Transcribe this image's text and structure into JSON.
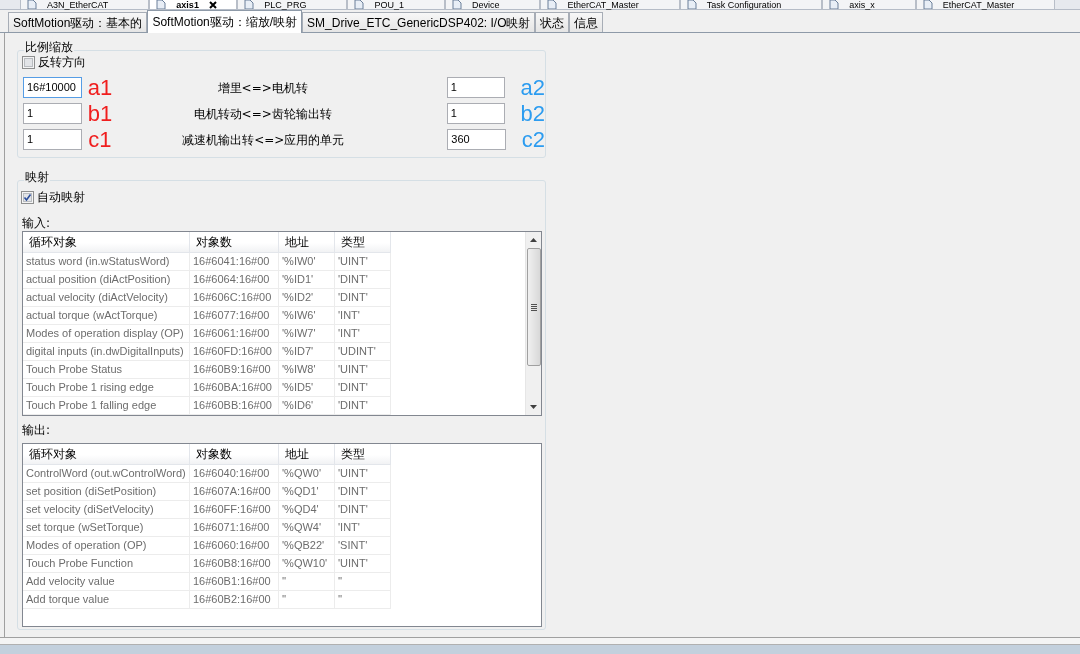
{
  "editor_tabs": [
    {
      "label": "A3N_EtherCAT",
      "selected": false
    },
    {
      "label": "axis1",
      "selected": true
    },
    {
      "label": "PLC_PRG",
      "selected": false
    },
    {
      "label": "POU_1",
      "selected": false
    },
    {
      "label": "Device",
      "selected": false
    },
    {
      "label": "EtherCAT_Master",
      "selected": false
    },
    {
      "label": "Task Configuration",
      "selected": false
    },
    {
      "label": "axis_x",
      "selected": false
    },
    {
      "label": "EtherCAT_Master",
      "selected": false
    }
  ],
  "subtabs": [
    {
      "label": "SoftMotion驱动：基本的",
      "selected": false
    },
    {
      "label": "SoftMotion驱动：缩放/映射",
      "selected": true
    },
    {
      "label": "SM_Drive_ETC_GenericDSP402: I/O映射",
      "selected": false
    },
    {
      "label": "状态",
      "selected": false
    },
    {
      "label": "信息",
      "selected": false
    }
  ],
  "scaling": {
    "title": "比例缩放",
    "invert": {
      "label": "反转方向",
      "checked": false
    },
    "rows": [
      {
        "left": {
          "value": "16#10000",
          "focused": true
        },
        "left_note": "a1",
        "label": "增里<=>电机转",
        "right": {
          "value": "1",
          "focused": false
        },
        "right_note": "a2"
      },
      {
        "left": {
          "value": "1",
          "focused": false
        },
        "left_note": "b1",
        "label": "电机转动<=>齿轮输出转",
        "right": {
          "value": "1",
          "focused": false
        },
        "right_note": "b2"
      },
      {
        "left": {
          "value": "1",
          "focused": false
        },
        "left_note": "c1",
        "label": "减速机输出转<=>应用的单元",
        "right": {
          "value": "360",
          "focused": false
        },
        "right_note": "c2"
      }
    ]
  },
  "mapping": {
    "title": "映射",
    "auto_map": {
      "label": "自动映射",
      "checked": true
    },
    "inputs": {
      "title": "输入:",
      "columns": [
        "循环对象",
        "对象数",
        "地址",
        "类型"
      ],
      "rows": [
        [
          "status word (in.wStatusWord)",
          "16#6041:16#00",
          "'%IW0'",
          "'UINT'"
        ],
        [
          "actual position (diActPosition)",
          "16#6064:16#00",
          "'%ID1'",
          "'DINT'"
        ],
        [
          "actual velocity (diActVelocity)",
          "16#606C:16#00",
          "'%ID2'",
          "'DINT'"
        ],
        [
          "actual torque (wActTorque)",
          "16#6077:16#00",
          "'%IW6'",
          "'INT'"
        ],
        [
          "Modes of operation display (OP)",
          "16#6061:16#00",
          "'%IW7'",
          "'INT'"
        ],
        [
          "digital inputs (in.dwDigitalInputs)",
          "16#60FD:16#00",
          "'%ID7'",
          "'UDINT'"
        ],
        [
          "Touch Probe Status",
          "16#60B9:16#00",
          "'%IW8'",
          "'UINT'"
        ],
        [
          "Touch Probe 1 rising edge",
          "16#60BA:16#00",
          "'%ID5'",
          "'DINT'"
        ],
        [
          "Touch Probe 1 falling edge",
          "16#60BB:16#00",
          "'%ID6'",
          "'DINT'"
        ]
      ]
    },
    "outputs": {
      "title": "输出:",
      "columns": [
        "循环对象",
        "对象数",
        "地址",
        "类型"
      ],
      "rows": [
        [
          "ControlWord (out.wControlWord)",
          "16#6040:16#00",
          "'%QW0'",
          "'UINT'"
        ],
        [
          "set position (diSetPosition)",
          "16#607A:16#00",
          "'%QD1'",
          "'DINT'"
        ],
        [
          "set velocity (diSetVelocity)",
          "16#60FF:16#00",
          "'%QD4'",
          "'DINT'"
        ],
        [
          "set torque (wSetTorque)",
          "16#6071:16#00",
          "'%QW4'",
          "'INT'"
        ],
        [
          "Modes of operation (OP)",
          "16#6060:16#00",
          "'%QB22'",
          "'SINT'"
        ],
        [
          "Touch Probe Function",
          "16#60B8:16#00",
          "'%QW10'",
          "'UINT'"
        ],
        [
          "Add velocity value",
          "16#60B1:16#00",
          "''",
          "''"
        ],
        [
          "Add torque value",
          "16#60B2:16#00",
          "''",
          "''"
        ]
      ]
    }
  }
}
